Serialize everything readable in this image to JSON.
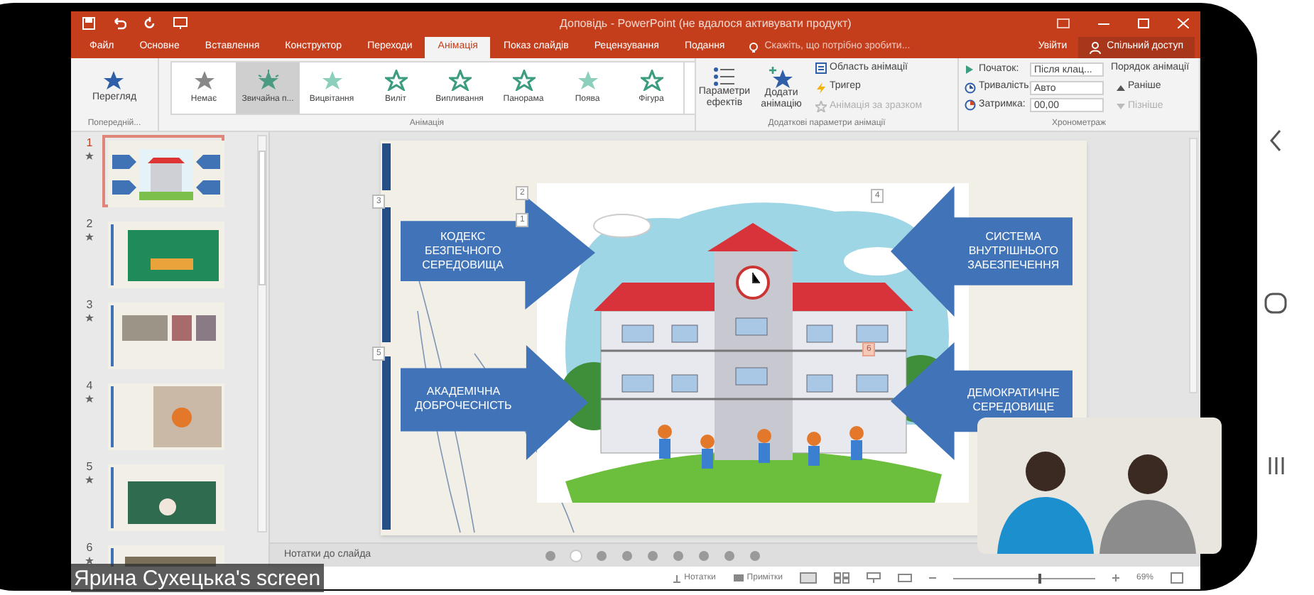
{
  "window": {
    "title": "Доповідь - PowerPoint (не вдалося активувати продукт)"
  },
  "menu_tabs": [
    {
      "label": "Файл",
      "selected": false
    },
    {
      "label": "Основне",
      "selected": false
    },
    {
      "label": "Вставлення",
      "selected": false
    },
    {
      "label": "Конструктор",
      "selected": false
    },
    {
      "label": "Переходи",
      "selected": false
    },
    {
      "label": "Анімація",
      "selected": true
    },
    {
      "label": "Показ слайдів",
      "selected": false
    },
    {
      "label": "Рецензування",
      "selected": false
    },
    {
      "label": "Подання",
      "selected": false
    }
  ],
  "tell_me": "Скажіть, що потрібно зробити...",
  "sign_in": "Увійти",
  "share": "Спільний доступ",
  "ribbon": {
    "preview": {
      "label": "Перегляд",
      "group": "Попередній..."
    },
    "animations": [
      {
        "label": "Немає",
        "selected": false,
        "kind": "none"
      },
      {
        "label": "Звичайна п...",
        "selected": true,
        "kind": "burst"
      },
      {
        "label": "Вицвітання",
        "selected": false,
        "kind": "star"
      },
      {
        "label": "Виліт",
        "selected": false,
        "kind": "outline"
      },
      {
        "label": "Випливання",
        "selected": false,
        "kind": "outline"
      },
      {
        "label": "Панорама",
        "selected": false,
        "kind": "outline"
      },
      {
        "label": "Поява",
        "selected": false,
        "kind": "star"
      },
      {
        "label": "Фігура",
        "selected": false,
        "kind": "outline"
      }
    ],
    "animations_group": "Анімація",
    "effect_options": "Параметри ефектів",
    "add_animation": "Додати анімацію",
    "advanced": [
      {
        "label": "Область анімації",
        "disabled": false,
        "kind": "pane"
      },
      {
        "label": "Тригер",
        "disabled": false,
        "kind": "trigger"
      },
      {
        "label": "Анімація за зразком",
        "disabled": true,
        "kind": "painter"
      }
    ],
    "advanced_group": "Додаткові параметри анімації",
    "timing": [
      {
        "label": "Початок:",
        "value": "Після клац...",
        "kind": "start"
      },
      {
        "label": "Тривалість:",
        "value": "Авто",
        "kind": "duration"
      },
      {
        "label": "Затримка:",
        "value": "00,00",
        "kind": "delay"
      }
    ],
    "reorder": {
      "title": "Порядок анімації",
      "items": [
        {
          "label": "Раніше",
          "disabled": false
        },
        {
          "label": "Пізніше",
          "disabled": true
        }
      ]
    },
    "timing_group": "Хронометраж"
  },
  "slides": [
    {
      "number": "1",
      "selected": true
    },
    {
      "number": "2",
      "selected": false
    },
    {
      "number": "3",
      "selected": false
    },
    {
      "number": "4",
      "selected": false
    },
    {
      "number": "5",
      "selected": false
    },
    {
      "number": "6",
      "selected": false
    }
  ],
  "slide": {
    "arrows": [
      {
        "text": "КОДЕКС БЕЗПЕЧНОГО СЕРЕДОВИЩА",
        "kind": "right"
      },
      {
        "text": "СИСТЕМА ВНУТРІШНЬОГО ЗАБЕЗПЕЧЕННЯ",
        "kind": "left"
      },
      {
        "text": "АКАДЕМІЧНА ДОБРОЧЕСНІСТЬ",
        "kind": "right"
      },
      {
        "text": "ДЕМОКРАТИЧНЕ СЕРЕДОВИЩЕ",
        "kind": "left"
      }
    ],
    "tags": [
      "3",
      "5",
      "2",
      "1",
      "4",
      "6"
    ]
  },
  "notes": "Нотатки до слайда",
  "status_bar": {
    "notes": "Нотатки",
    "comments": "Примітки",
    "zoom": "69%",
    "zoom_slider": {
      "level": 0.6
    }
  },
  "screen_share_label": "Ярина Сухецька's screen",
  "pager": [
    {
      "selected": false
    },
    {
      "selected": true
    },
    {
      "selected": false
    },
    {
      "selected": false
    },
    {
      "selected": false
    },
    {
      "selected": false
    },
    {
      "selected": false
    },
    {
      "selected": false
    },
    {
      "selected": false
    }
  ]
}
